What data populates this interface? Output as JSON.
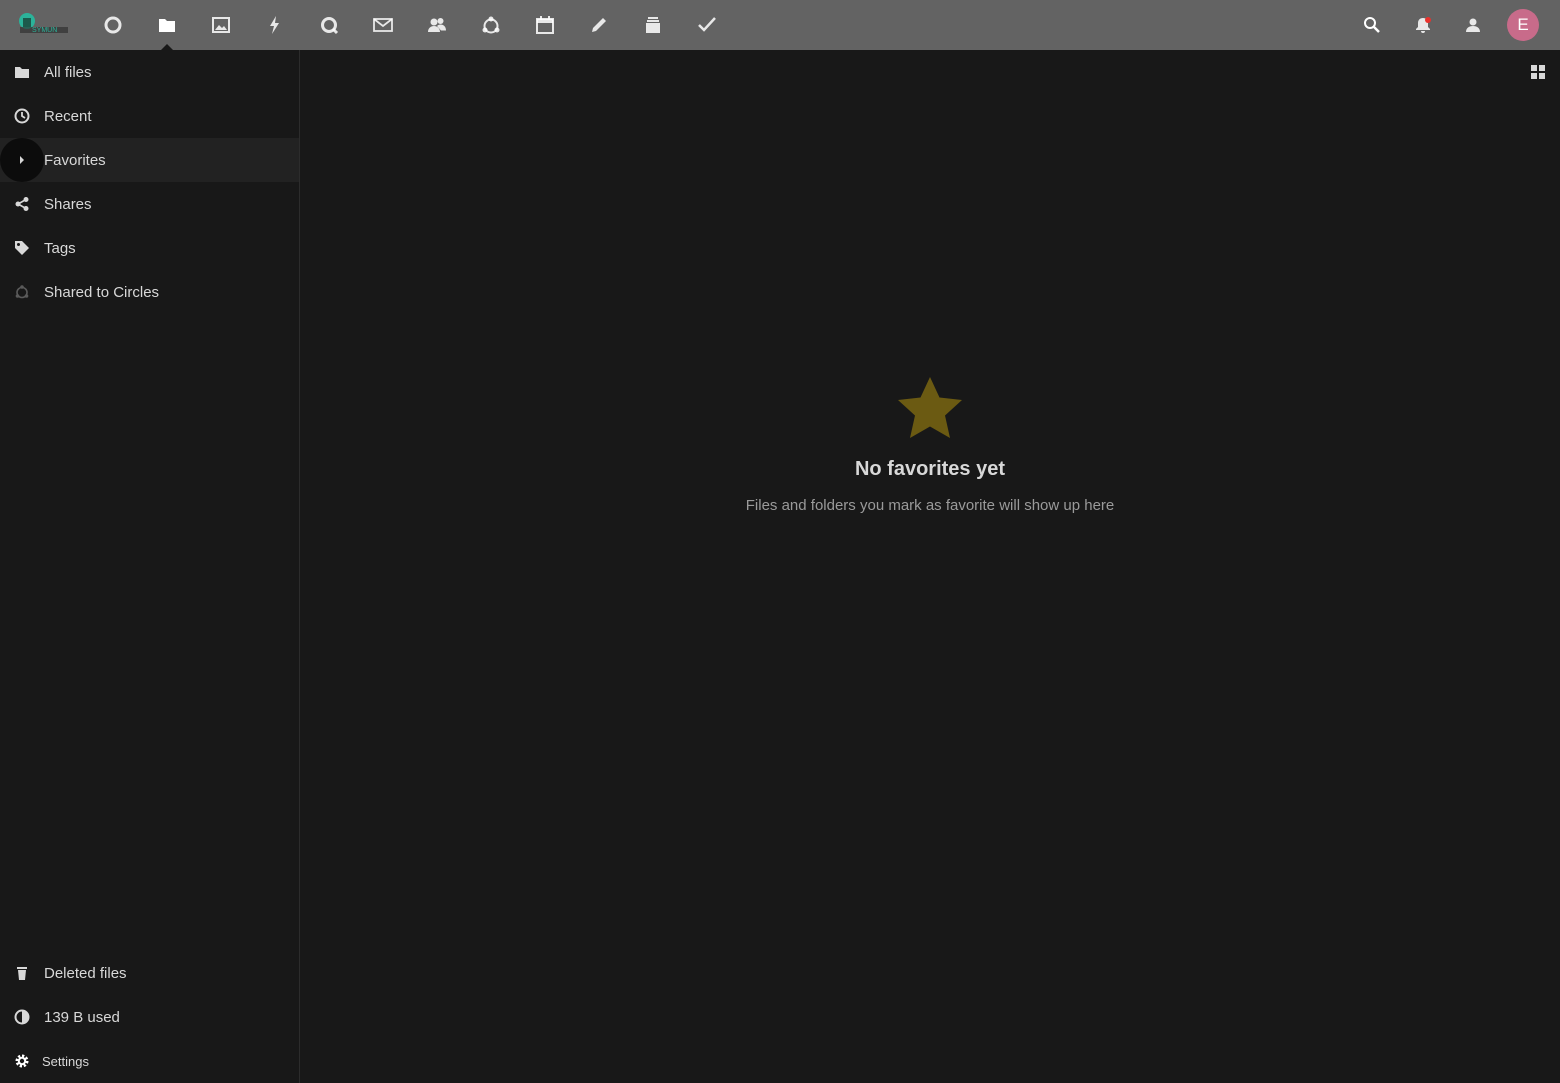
{
  "header": {
    "apps": [
      {
        "name": "dashboard-icon",
        "active": false
      },
      {
        "name": "files-icon",
        "active": true
      },
      {
        "name": "photos-icon",
        "active": false
      },
      {
        "name": "activity-icon",
        "active": false
      },
      {
        "name": "talk-icon",
        "active": false
      },
      {
        "name": "mail-icon",
        "active": false
      },
      {
        "name": "contacts-icon",
        "active": false
      },
      {
        "name": "circles-icon",
        "active": false
      },
      {
        "name": "calendar-icon",
        "active": false
      },
      {
        "name": "notes-icon",
        "active": false
      },
      {
        "name": "deck-icon",
        "active": false
      },
      {
        "name": "tasks-icon",
        "active": false
      }
    ],
    "avatar_initial": "E",
    "avatar_color": "#c86b8a",
    "notification_dot_color": "#e9322d"
  },
  "sidebar": {
    "items": [
      {
        "label": "All files",
        "icon": "folder-icon"
      },
      {
        "label": "Recent",
        "icon": "clock-icon"
      },
      {
        "label": "Favorites",
        "icon": "chevron-right-icon",
        "active": true
      },
      {
        "label": "Shares",
        "icon": "share-icon"
      },
      {
        "label": "Tags",
        "icon": "tag-icon"
      },
      {
        "label": "Shared to Circles",
        "icon": "circles-icon"
      }
    ],
    "deleted_label": "Deleted files",
    "quota_label": "139 B used",
    "settings_label": "Settings"
  },
  "main": {
    "empty_title": "No favorites yet",
    "empty_text": "Files and folders you mark as favorite will show up here",
    "star_color": "#6b5a12"
  }
}
